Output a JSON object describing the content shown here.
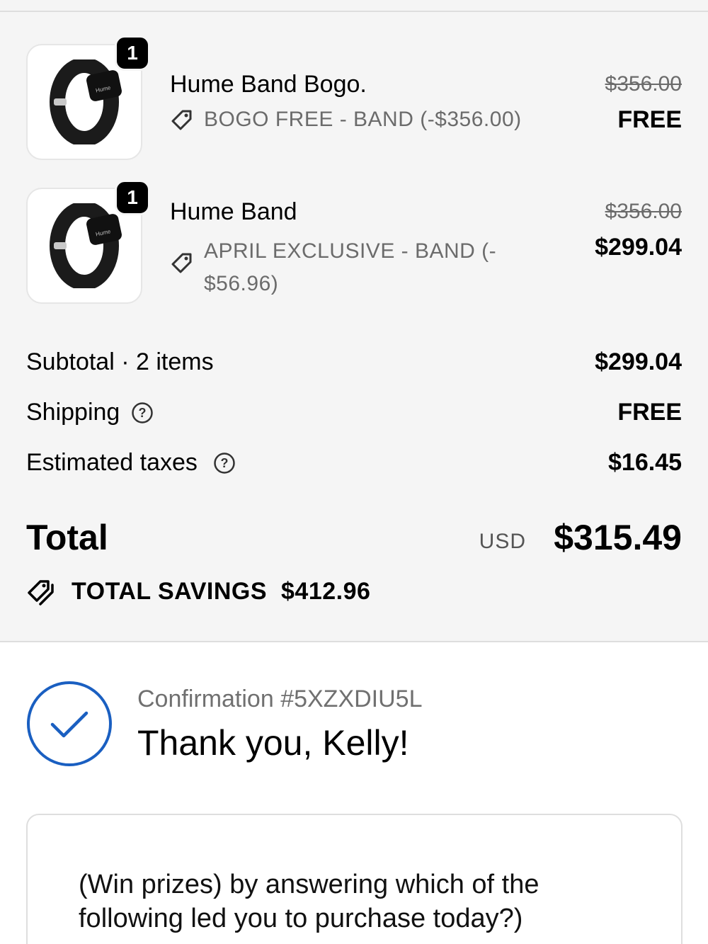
{
  "items": [
    {
      "quantity": "1",
      "title": "Hume Band Bogo.",
      "discount_line1": "BOGO FREE - BAND (-$356.00)",
      "discount_line2": "",
      "original_price": "$356.00",
      "final_price": "FREE",
      "icon": "tag-icon"
    },
    {
      "quantity": "1",
      "title": "Hume Band",
      "discount_line1": "APRIL EXCLUSIVE - BAND (-",
      "discount_line2": "$56.96)",
      "original_price": "$356.00",
      "final_price": "$299.04",
      "icon": "tag-icon"
    }
  ],
  "summary": {
    "subtotal_label": "Subtotal · 2 items",
    "subtotal_value": "$299.04",
    "shipping_label": "Shipping",
    "shipping_value": "FREE",
    "taxes_label": "Estimated taxes",
    "taxes_value": "$16.45",
    "total_label": "Total",
    "total_currency": "USD",
    "total_value": "$315.49",
    "savings_label": "TOTAL SAVINGS",
    "savings_value": "$412.96"
  },
  "confirmation": {
    "number": "Confirmation #5XZXDIU5L",
    "thanks": "Thank you, Kelly!",
    "accent_color": "#1a5fc1"
  },
  "survey": {
    "prompt": "(Win prizes) by answering which of the following led you to purchase today?)"
  },
  "product_logo_text": "Hume"
}
